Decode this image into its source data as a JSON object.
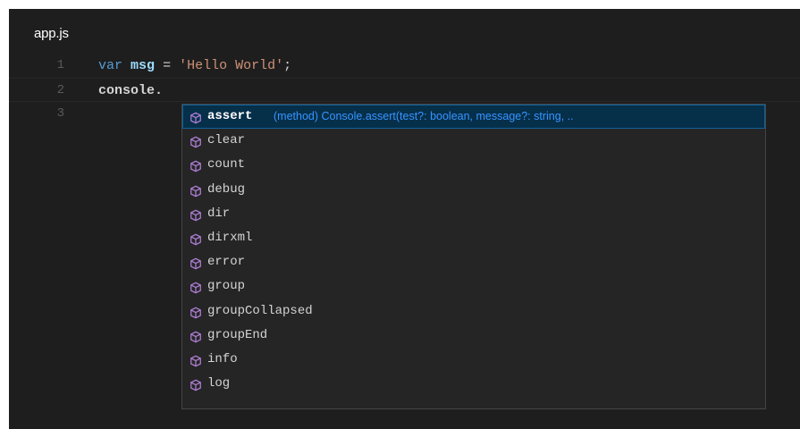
{
  "editor": {
    "tab_title": "app.js",
    "lines": [
      {
        "number": "1",
        "keyword": "var",
        "identifier": "msg",
        "operator": "=",
        "string": "'Hello World'",
        "terminator": ";"
      },
      {
        "number": "2",
        "object": "console",
        "dot": "."
      },
      {
        "number": "3"
      }
    ]
  },
  "suggest": {
    "selected_label": "assert",
    "selected_detail": "(method) Console.assert(test?: boolean, message?: string, ..",
    "items": [
      "assert",
      "clear",
      "count",
      "debug",
      "dir",
      "dirxml",
      "error",
      "group",
      "groupCollapsed",
      "groupEnd",
      "info",
      "log"
    ],
    "icon": "method-cube-icon",
    "icon_color": "#b180d7"
  },
  "colors": {
    "background": "#1e1e1e",
    "keyword": "#569cd6",
    "variable": "#9cdcfe",
    "string": "#ce9178",
    "suggest_selected": "#062f4a",
    "detail_text": "#3794ff"
  }
}
